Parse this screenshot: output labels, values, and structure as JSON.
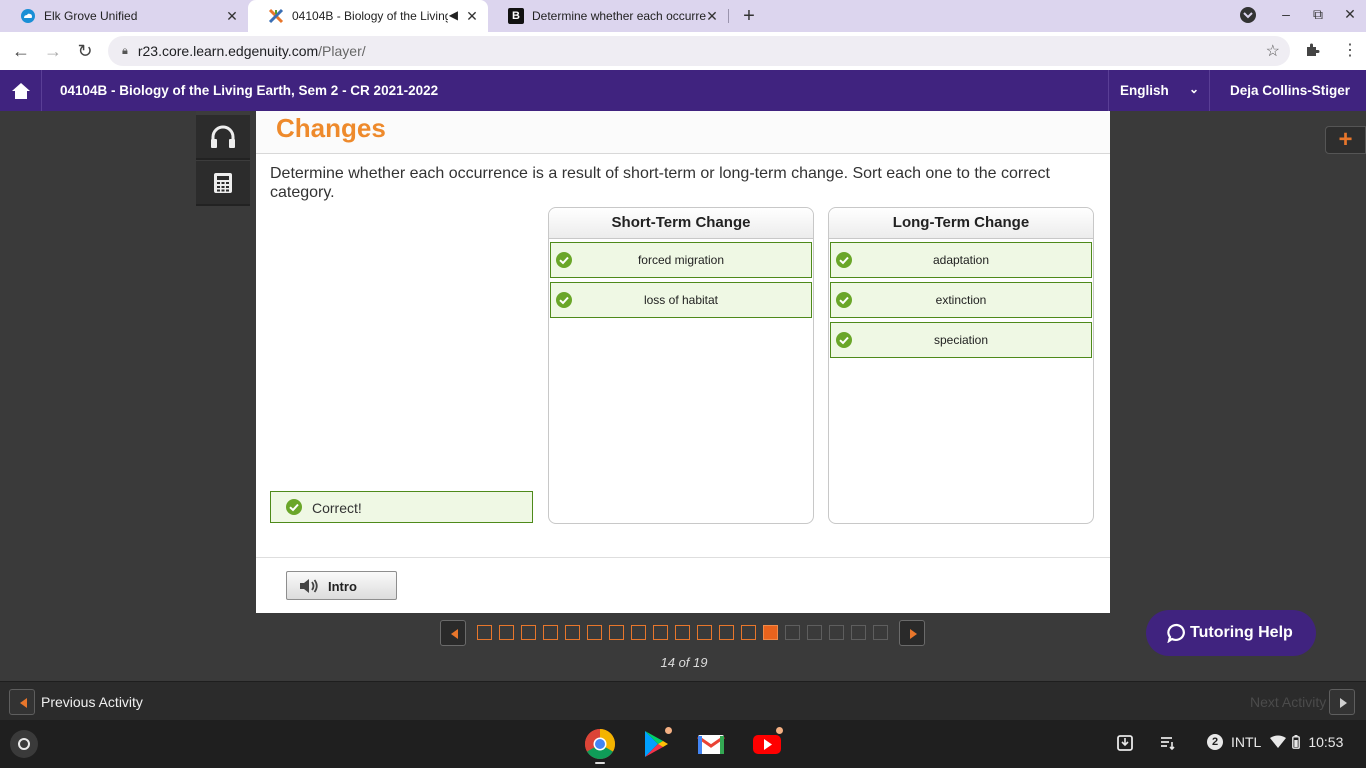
{
  "browser": {
    "tabs": [
      {
        "title": "Elk Grove Unified",
        "active": false,
        "favicon": "cloud-icon"
      },
      {
        "title": "04104B - Biology of the Living",
        "active": true,
        "favicon": "edgenuity-icon",
        "audio": "speaker-icon"
      },
      {
        "title": "Determine whether each occurre",
        "active": false,
        "favicon": "brainly-icon"
      }
    ],
    "url_host": "r23.core.learn.edgenuity.com",
    "url_path": "/Player/"
  },
  "app_header": {
    "course_title": "04104B - Biology of the Living Earth, Sem 2 - CR 2021-2022",
    "language": "English",
    "user_name": "Deja Collins-Stiger"
  },
  "activity": {
    "title": "Changes",
    "instructions": "Determine whether each occurrence is a result of short-term or long-term change. Sort each one to the correct category.",
    "columns": [
      {
        "heading": "Short-Term Change",
        "items": [
          "forced migration",
          "loss of habitat"
        ]
      },
      {
        "heading": "Long-Term Change",
        "items": [
          "adaptation",
          "extinction",
          "speciation"
        ]
      }
    ],
    "feedback": "Correct!",
    "intro_button": "Intro"
  },
  "pager": {
    "current": 14,
    "total": 19,
    "label": "14 of 19"
  },
  "tutoring_button": "Tutoring Help",
  "bottom_bar": {
    "previous_label": "Previous Activity",
    "next_label": "Next Activity"
  },
  "system_tray": {
    "notifications": "2",
    "keyboard": "INTL",
    "time": "10:53"
  },
  "colors": {
    "brand_purple": "#40237f",
    "accent_orange": "#ee8a2c",
    "correct_green": "#6aa629"
  }
}
